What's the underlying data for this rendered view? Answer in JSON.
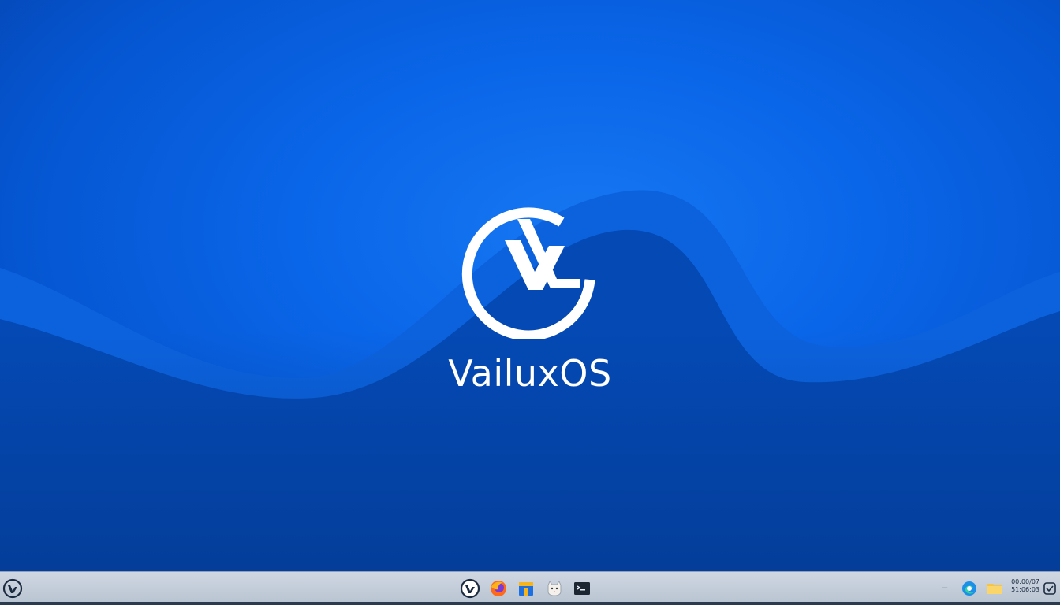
{
  "desktop": {
    "brand_name": "VailuxOS",
    "logo_icon": "vailuxos-logo-icon",
    "colors": {
      "wallpaper_primary": "#0a66e8",
      "wallpaper_dark": "#0446b0",
      "wave_band": "#0e5fd9",
      "logo": "#ffffff"
    }
  },
  "taskbar": {
    "start_icon": "vailuxos-start-icon",
    "pinned_apps": [
      {
        "icon": "vailuxos-app-icon"
      },
      {
        "icon": "firefox-browser-icon"
      },
      {
        "icon": "store-icon"
      },
      {
        "icon": "cat-app-icon"
      },
      {
        "icon": "terminal-icon"
      }
    ],
    "tray": {
      "minimize_symbol": "–",
      "icons": [
        "edge-browser-icon",
        "folder-icon",
        "checklist-icon"
      ],
      "clock_line1": "00:00/07",
      "clock_line2": "51:06:03"
    },
    "colors": {
      "bar_background": "#c5cedb",
      "bar_text": "#1b2a3e"
    }
  }
}
